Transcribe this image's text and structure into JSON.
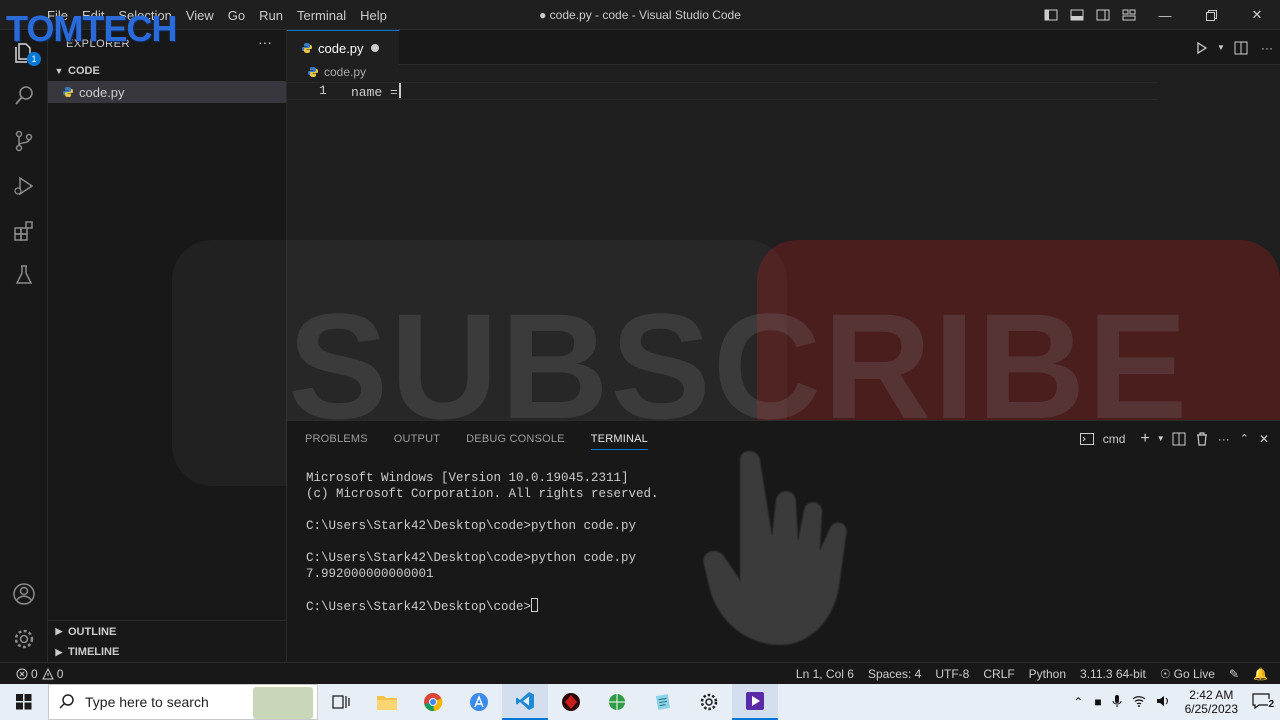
{
  "watermark": {
    "brand": "TOMTECH",
    "subscribe": "SUBSCRIBE"
  },
  "titlebar": {
    "menu": [
      "File",
      "Edit",
      "Selection",
      "View",
      "Go",
      "Run",
      "Terminal",
      "Help"
    ],
    "title": "● code.py - code - Visual Studio Code"
  },
  "activity_bar": {
    "icons": [
      "explorer-icon",
      "search-icon",
      "source-control-icon",
      "run-debug-icon",
      "extensions-icon",
      "testing-icon",
      "accounts-icon",
      "manage-gear-icon"
    ],
    "explorer_badge": "1"
  },
  "sidebar": {
    "title": "EXPLORER",
    "folder": "CODE",
    "file": "code.py",
    "outline": "OUTLINE",
    "timeline": "TIMELINE"
  },
  "editor": {
    "tab": "code.py",
    "breadcrumb": "code.py",
    "line_number": "1",
    "code": "name ="
  },
  "panel": {
    "tabs": [
      "PROBLEMS",
      "OUTPUT",
      "DEBUG CONSOLE",
      "TERMINAL"
    ],
    "active_tab": "TERMINAL",
    "shell": "cmd",
    "terminal_lines": [
      "Microsoft Windows [Version 10.0.19045.2311]",
      "(c) Microsoft Corporation. All rights reserved.",
      "",
      "C:\\Users\\Stark42\\Desktop\\code>python code.py",
      "",
      "C:\\Users\\Stark42\\Desktop\\code>python code.py",
      "7.992000000000001",
      "",
      "C:\\Users\\Stark42\\Desktop\\code>"
    ]
  },
  "statusbar": {
    "errors": "0",
    "warnings": "0",
    "position": "Ln 1, Col 6",
    "spaces": "Spaces: 4",
    "encoding": "UTF-8",
    "eol": "CRLF",
    "language": "Python",
    "interpreter": "3.11.3 64-bit",
    "golive": "Go Live"
  },
  "taskbar": {
    "search_placeholder": "Type here to search",
    "time": "2:42 AM",
    "date": "6/25/2023",
    "notifications": "2"
  },
  "colors": {
    "accent": "#0078d4",
    "editor_bg": "#1f1f1f",
    "sidebar_bg": "#181818",
    "taskbar_bg": "#e8eef6"
  }
}
